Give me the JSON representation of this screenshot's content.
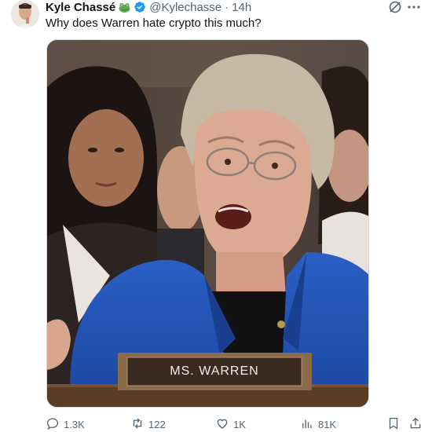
{
  "author": {
    "name": "Kyle Chassé",
    "handle": "@Kylechasse",
    "separator": "·",
    "time": "14h",
    "badges": [
      "frog-icon",
      "verified-icon"
    ]
  },
  "tweet": {
    "text": "Why does Warren hate crypto this much?"
  },
  "media": {
    "nameplate": "MS. WARREN"
  },
  "actions": {
    "reply_count": "1.3K",
    "retweet_count": "122",
    "like_count": "1K",
    "views_count": "81K"
  },
  "icons": {
    "top_right": [
      "grok-icon",
      "more-icon"
    ],
    "actions": [
      "reply-icon",
      "retweet-icon",
      "like-icon",
      "views-icon",
      "bookmark-icon",
      "share-icon"
    ]
  },
  "colors": {
    "text_primary": "#0f1419",
    "text_secondary": "#536471",
    "verified": "#1d9bf0",
    "frog": "#5fa854"
  }
}
